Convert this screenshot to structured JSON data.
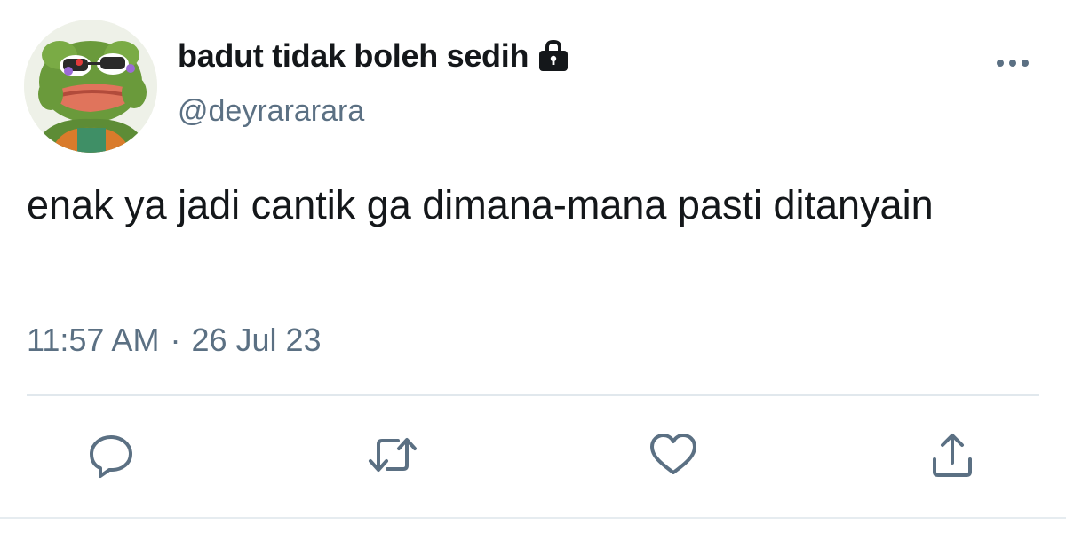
{
  "user": {
    "display_name": "badut tidak boleh sedih",
    "handle": "@deyrararara",
    "avatar_icon": "pepe-avatar",
    "protected_icon": "lock-icon"
  },
  "tweet": {
    "text": "enak ya jadi cantik ga dimana-mana pasti ditanyain",
    "time": "11:57 AM",
    "separator": "·",
    "date": "26 Jul 23"
  },
  "actions": {
    "reply_icon": "reply-icon",
    "retweet_icon": "retweet-icon",
    "like_icon": "heart-icon",
    "share_icon": "share-icon",
    "more_icon": "more-icon"
  },
  "colors": {
    "text": "#14171a",
    "secondary": "#5b7083",
    "divider": "#e1e8ed"
  }
}
